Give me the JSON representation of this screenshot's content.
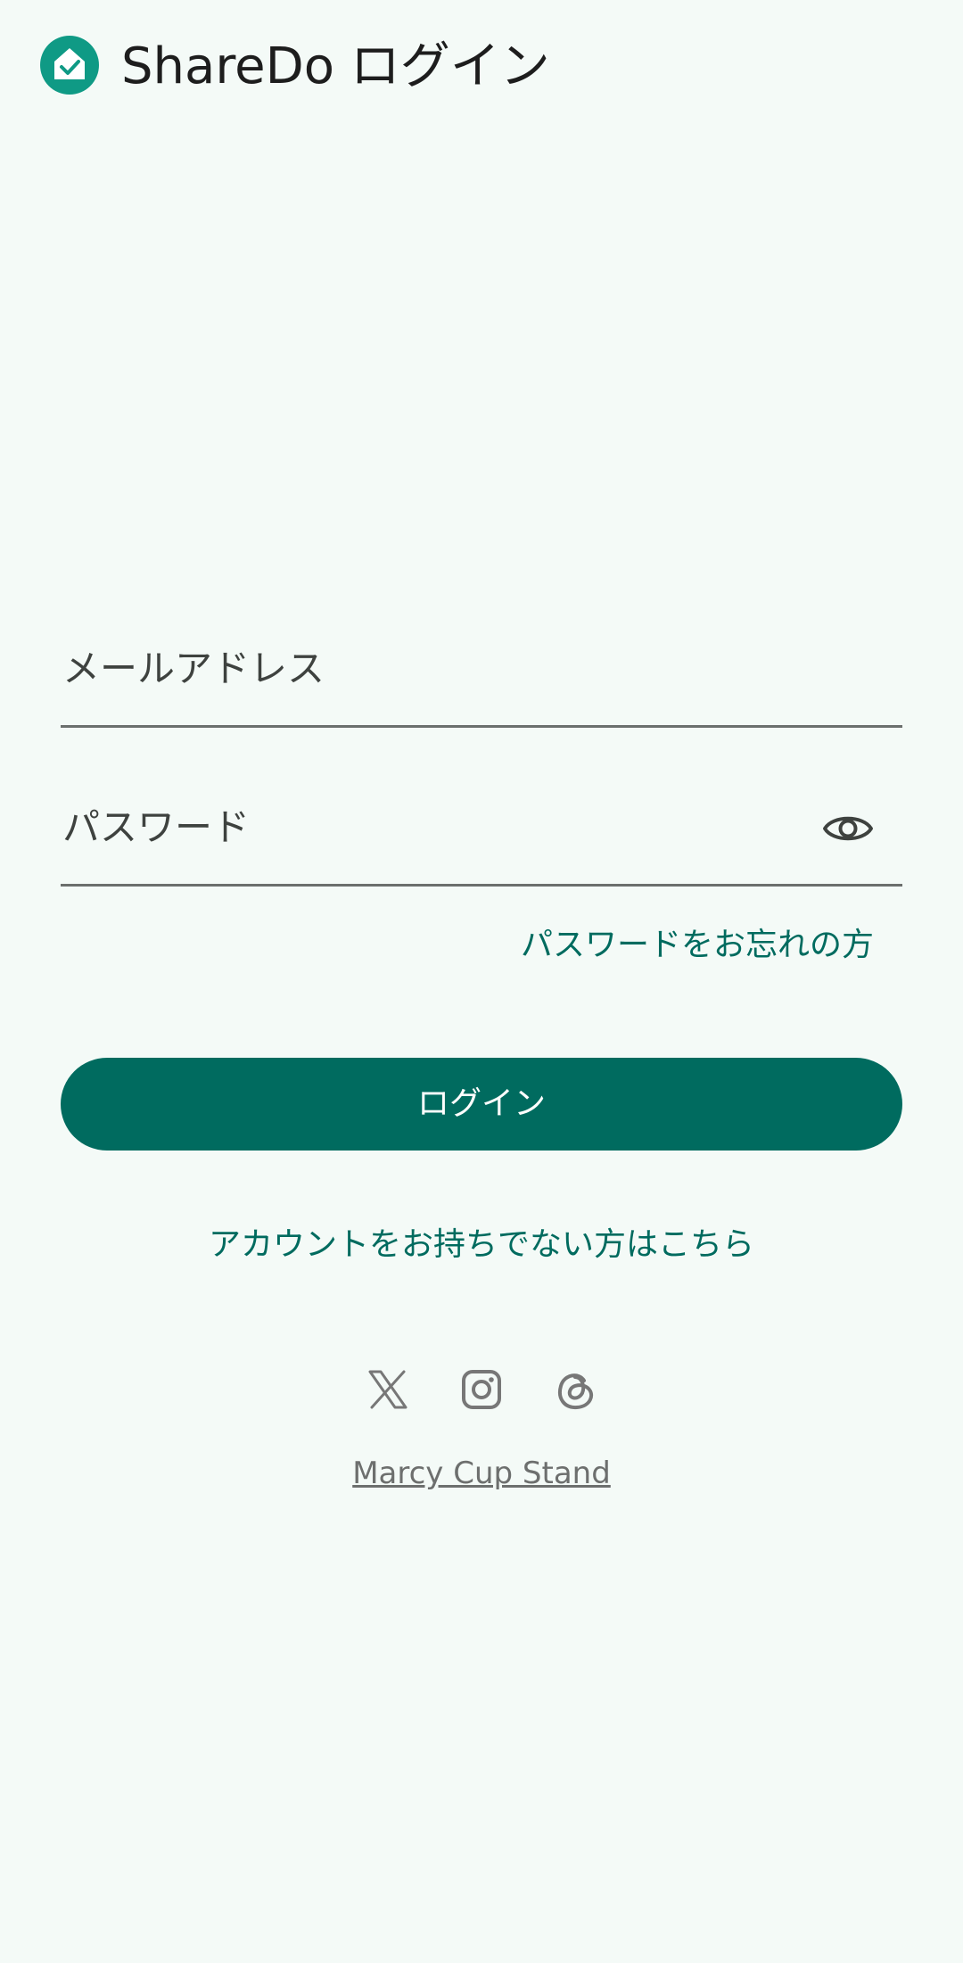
{
  "app_bar": {
    "title": "ShareDo ログイン",
    "logo_icon": "house-check-icon"
  },
  "form": {
    "email_label": "メールアドレス",
    "password_label": "パスワード",
    "password_toggle_icon": "eye-icon",
    "forgot_password": "パスワードをお忘れの方",
    "login_button": "ログイン",
    "signup_link": "アカウントをお持ちでない方はこちら"
  },
  "social": {
    "icons": [
      "x-icon",
      "instagram-icon",
      "threads-icon"
    ]
  },
  "footer": {
    "link": "Marcy Cup Stand"
  },
  "colors": {
    "background": "#f4faf7",
    "primary": "#006b5f",
    "logo": "#0f9a85",
    "text": "#1d1d1d",
    "muted": "#6d6f6e"
  }
}
